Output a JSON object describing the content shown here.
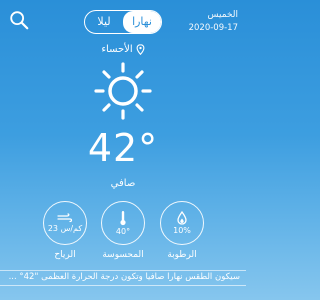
{
  "header": {
    "search_icon": "search-icon",
    "toggle": {
      "night_label": "ليلا",
      "day_label": "نهارا",
      "selected": "day"
    },
    "day_name": "الخميس",
    "date": "2020-09-17"
  },
  "location": {
    "icon": "location-pin-icon",
    "name": "الأحساء"
  },
  "weather": {
    "icon": "sun-icon",
    "temperature": "42°",
    "condition": "صافي"
  },
  "stats": {
    "wind": {
      "icon": "wind-icon",
      "value": "23 كم/س",
      "label": "الرياح"
    },
    "felt_temp": {
      "icon": "thermometer-icon",
      "value": "40°",
      "label": "المحسوسة"
    },
    "humidity": {
      "icon": "humidity-drop-icon",
      "value": "10%",
      "label": "الرطوبة"
    }
  },
  "summary": "سيكون الطقس نهاراً صافياً وتكون درجة الحرارة العظمى \"42° ...",
  "colors": {
    "background_top": "#2a8fd8",
    "background_bottom": "#86c6ee",
    "text": "#ffffff"
  }
}
